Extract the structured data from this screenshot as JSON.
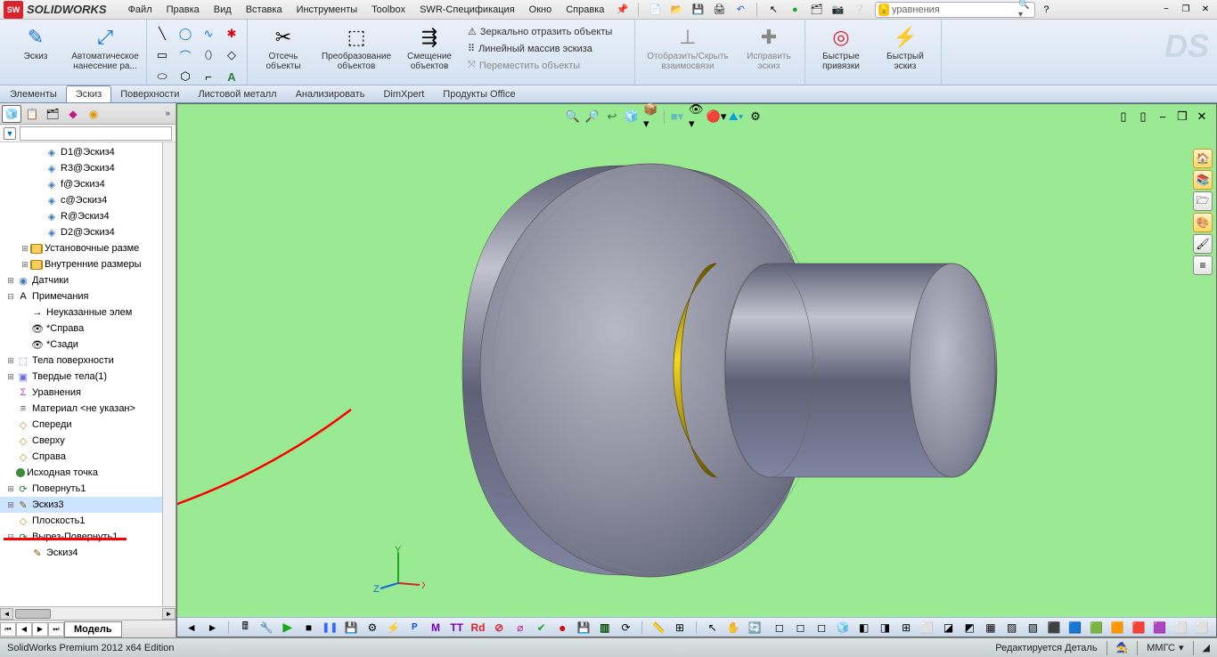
{
  "brand": "SOLIDWORKS",
  "menu": [
    "Файл",
    "Правка",
    "Вид",
    "Вставка",
    "Инструменты",
    "Toolbox",
    "SWR-Спецификация",
    "Окно",
    "Справка"
  ],
  "search_value": "уравнения",
  "ribbon": {
    "sketch_big": "Эскиз",
    "autodim_big": "Автоматическое нанесение ра...",
    "trim_big": "Отсечь объекты",
    "convert_big": "Преобразование объектов",
    "offset_big": "Смещение объектов",
    "mirror": "Зеркально отразить объекты",
    "pattern": "Линейный массив эскиза",
    "move": "Переместить объекты",
    "relations": "Отобразить/Скрыть взаимосвязи",
    "repair": "Исправить эскиз",
    "snaps": "Быстрые привязки",
    "quick": "Быстрый эскиз"
  },
  "tabs": [
    "Элементы",
    "Эскиз",
    "Поверхности",
    "Листовой металл",
    "Анализировать",
    "DimXpert",
    "Продукты Office"
  ],
  "active_tab_idx": 1,
  "bottom_tab": "Модель",
  "tree": [
    {
      "ind": 2,
      "ico": "dim",
      "type": "",
      "lbl": "D1@Эскиз4"
    },
    {
      "ind": 2,
      "ico": "dim",
      "type": "",
      "lbl": "R3@Эскиз4"
    },
    {
      "ind": 2,
      "ico": "dim",
      "type": "",
      "lbl": "f@Эскиз4"
    },
    {
      "ind": 2,
      "ico": "dim",
      "type": "",
      "lbl": "c@Эскиз4"
    },
    {
      "ind": 2,
      "ico": "dim",
      "type": "",
      "lbl": "R@Эскиз4"
    },
    {
      "ind": 2,
      "ico": "dim",
      "type": "",
      "lbl": "D2@Эскиз4"
    },
    {
      "ind": 1,
      "ico": "fold",
      "type": "exp",
      "lbl": "Установочные разме"
    },
    {
      "ind": 1,
      "ico": "fold",
      "type": "exp",
      "lbl": "Внутренние размеры"
    },
    {
      "ind": 0,
      "ico": "sens",
      "type": "exp",
      "lbl": "Датчики"
    },
    {
      "ind": 0,
      "ico": "ann",
      "type": "col",
      "lbl": "Примечания"
    },
    {
      "ind": 1,
      "ico": "note",
      "type": "",
      "lbl": "Неуказанные элем"
    },
    {
      "ind": 1,
      "ico": "view",
      "type": "",
      "lbl": "*Справа"
    },
    {
      "ind": 1,
      "ico": "view",
      "type": "",
      "lbl": "*Сзади"
    },
    {
      "ind": 0,
      "ico": "surf",
      "type": "exp",
      "lbl": "Тела поверхности"
    },
    {
      "ind": 0,
      "ico": "sol",
      "type": "exp",
      "lbl": "Твердые тела(1)"
    },
    {
      "ind": 0,
      "ico": "eq",
      "type": "",
      "lbl": "Уравнения"
    },
    {
      "ind": 0,
      "ico": "mat",
      "type": "",
      "lbl": "Материал <не указан>"
    },
    {
      "ind": 0,
      "ico": "plane",
      "type": "",
      "lbl": "Спереди"
    },
    {
      "ind": 0,
      "ico": "plane",
      "type": "",
      "lbl": "Сверху"
    },
    {
      "ind": 0,
      "ico": "plane",
      "type": "",
      "lbl": "Справа"
    },
    {
      "ind": 0,
      "ico": "org",
      "type": "",
      "lbl": "Исходная точка"
    },
    {
      "ind": 0,
      "ico": "feat",
      "type": "exp",
      "lbl": "Повернуть1"
    },
    {
      "ind": 0,
      "ico": "sketch",
      "type": "exp",
      "lbl": "Эскиз3"
    },
    {
      "ind": 0,
      "ico": "plane",
      "type": "",
      "lbl": "Плоскость1"
    },
    {
      "ind": 0,
      "ico": "feat",
      "type": "col",
      "lbl": "Вырез-Повернуть1"
    },
    {
      "ind": 1,
      "ico": "sketch",
      "type": "",
      "lbl": "Эскиз4"
    }
  ],
  "tree_selected_idx": 22,
  "status_left": "SolidWorks Premium 2012 x64 Edition",
  "status_editing": "Редактируется Деталь",
  "status_units": "ММГС",
  "triad": {
    "x": "X",
    "y": "Y",
    "z": "Z"
  }
}
